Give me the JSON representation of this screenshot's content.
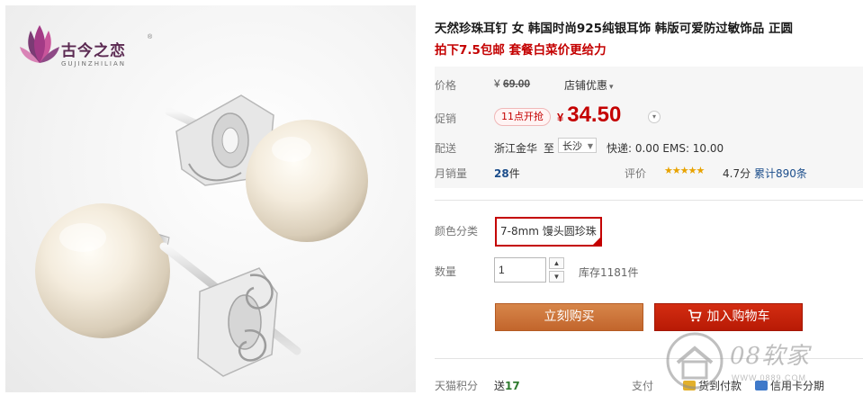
{
  "brand": {
    "name": "古今之恋",
    "pinyin": "GUJINZHILIAN",
    "registered_mark": "®"
  },
  "product": {
    "title": "天然珍珠耳钉 女 韩国时尚925纯银耳饰 韩版可爱防过敏饰品 正圆",
    "promo": "拍下7.5包邮 套餐白菜价更给力"
  },
  "price": {
    "label": "价格",
    "currency": "¥",
    "original": "69.00",
    "shop_discount": "店铺优惠",
    "sale_label": "促销",
    "timer_badge": "11点开抢",
    "sale": "34.50"
  },
  "shipping": {
    "label": "配送",
    "from": "浙江金华",
    "to_word": "至",
    "city": "长沙",
    "fee": "快递: 0.00 EMS: 10.00"
  },
  "sales": {
    "label": "月销量",
    "count": "28",
    "unit": "件",
    "rating_label": "评价",
    "stars": "★★★★★",
    "stars_value": 4.7,
    "score": "4.7分",
    "review_link": "累计890条"
  },
  "sku": {
    "label": "颜色分类",
    "selected": "7-8mm 馒头圆珍珠"
  },
  "quantity": {
    "label": "数量",
    "value": "1",
    "stock": "库存1181件"
  },
  "actions": {
    "buy_now": "立刻购买",
    "add_to_cart": "加入购物车"
  },
  "points": {
    "label": "天猫积分",
    "value_prefix": "送",
    "value": "17"
  },
  "payment": {
    "label": "支付",
    "methods": [
      "货到付款",
      "信用卡分期"
    ]
  },
  "watermark": {
    "text": "08软家",
    "url": "WWW.0889.COM"
  },
  "colors": {
    "price_red": "#c40000",
    "buy_orange": "#c8703a",
    "cart_red": "#c1200b",
    "link_blue": "#1b4d8b"
  }
}
